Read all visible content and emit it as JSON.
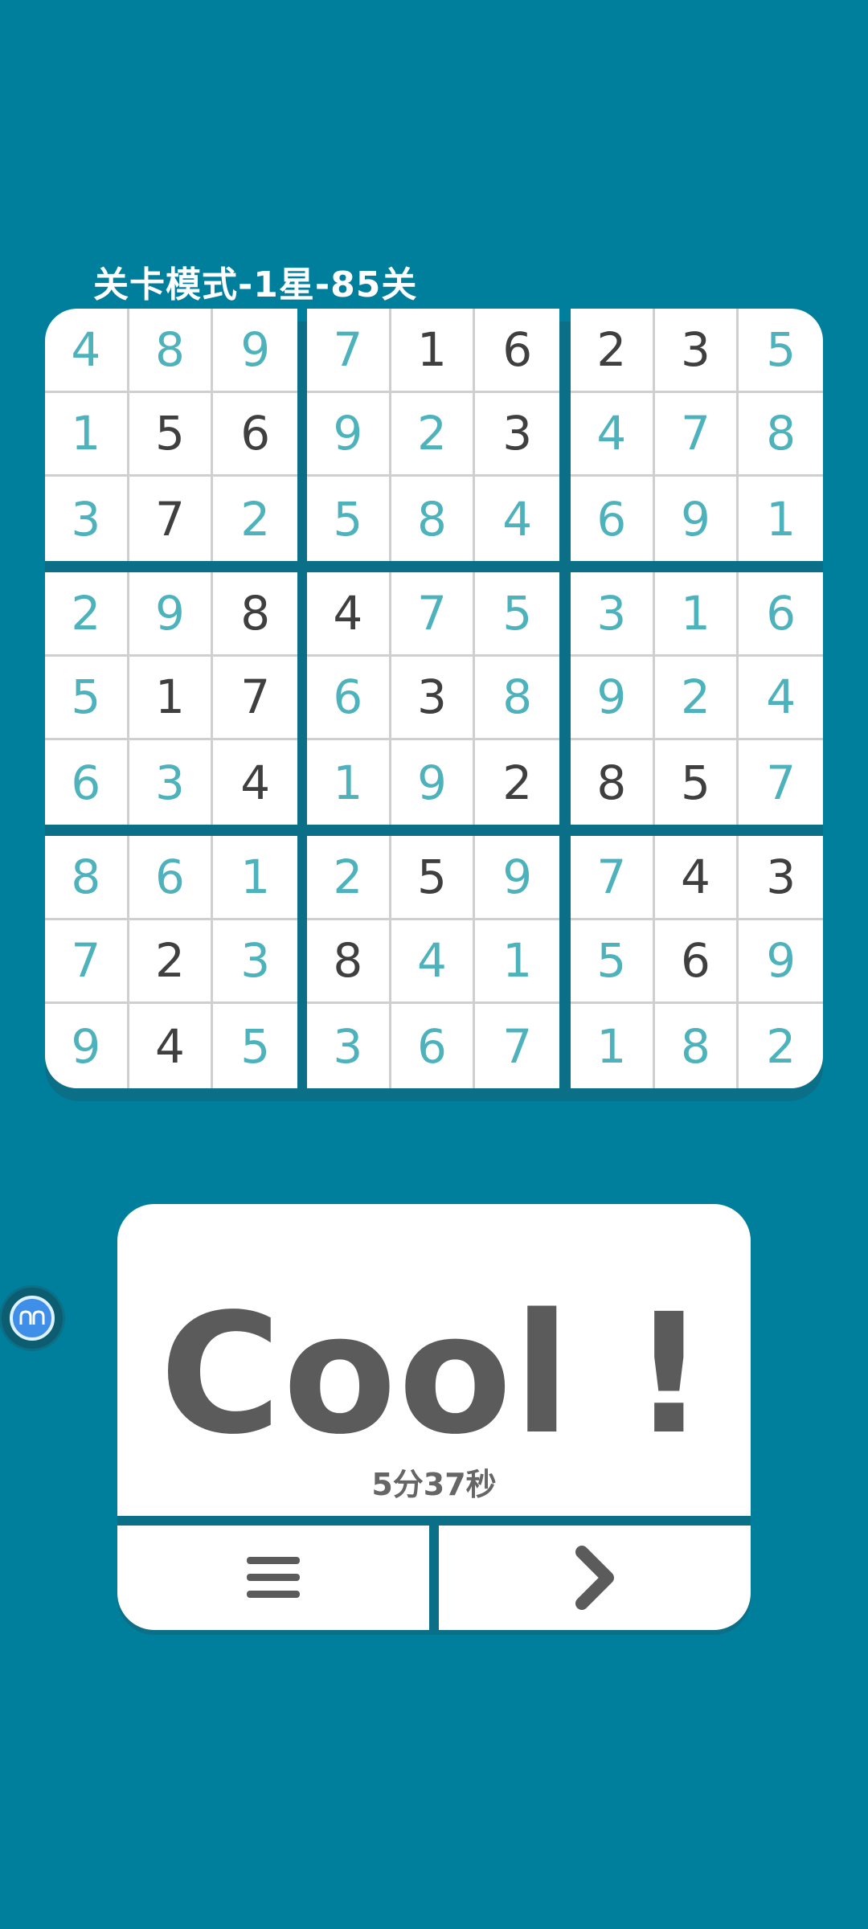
{
  "header": {
    "title": "关卡模式-1星-85关"
  },
  "board": {
    "rows": [
      [
        "4",
        "8",
        "9",
        "7",
        "1",
        "6",
        "2",
        "3",
        "5"
      ],
      [
        "1",
        "5",
        "6",
        "9",
        "2",
        "3",
        "4",
        "7",
        "8"
      ],
      [
        "3",
        "7",
        "2",
        "5",
        "8",
        "4",
        "6",
        "9",
        "1"
      ],
      [
        "2",
        "9",
        "8",
        "4",
        "7",
        "5",
        "3",
        "1",
        "6"
      ],
      [
        "5",
        "1",
        "7",
        "6",
        "3",
        "8",
        "9",
        "2",
        "4"
      ],
      [
        "6",
        "3",
        "4",
        "1",
        "9",
        "2",
        "8",
        "5",
        "7"
      ],
      [
        "8",
        "6",
        "1",
        "2",
        "5",
        "9",
        "7",
        "4",
        "3"
      ],
      [
        "7",
        "2",
        "3",
        "8",
        "4",
        "1",
        "5",
        "6",
        "9"
      ],
      [
        "9",
        "4",
        "5",
        "3",
        "6",
        "7",
        "1",
        "8",
        "2"
      ]
    ],
    "given": [
      [
        0,
        0,
        0,
        0,
        1,
        1,
        1,
        1,
        0
      ],
      [
        0,
        1,
        1,
        0,
        0,
        1,
        0,
        0,
        0
      ],
      [
        0,
        1,
        0,
        0,
        0,
        0,
        0,
        0,
        0
      ],
      [
        0,
        0,
        1,
        1,
        0,
        0,
        0,
        0,
        0
      ],
      [
        0,
        1,
        1,
        0,
        1,
        0,
        0,
        0,
        0
      ],
      [
        0,
        0,
        1,
        0,
        0,
        1,
        1,
        1,
        0
      ],
      [
        0,
        0,
        0,
        0,
        1,
        0,
        0,
        1,
        1
      ],
      [
        0,
        1,
        0,
        1,
        0,
        0,
        0,
        1,
        0
      ],
      [
        0,
        1,
        0,
        0,
        0,
        0,
        0,
        0,
        0
      ]
    ]
  },
  "result": {
    "message": "Cool !",
    "time": "5分37秒"
  },
  "buttons": {
    "menu_icon": "menu-icon",
    "next_icon": "chevron-right-icon"
  },
  "floating": {
    "icon": "assistant-icon"
  },
  "colors": {
    "background": "#007f9c",
    "given_digit": "#3f3f3f",
    "filled_digit": "#4db2bb",
    "card": "#ffffff"
  }
}
